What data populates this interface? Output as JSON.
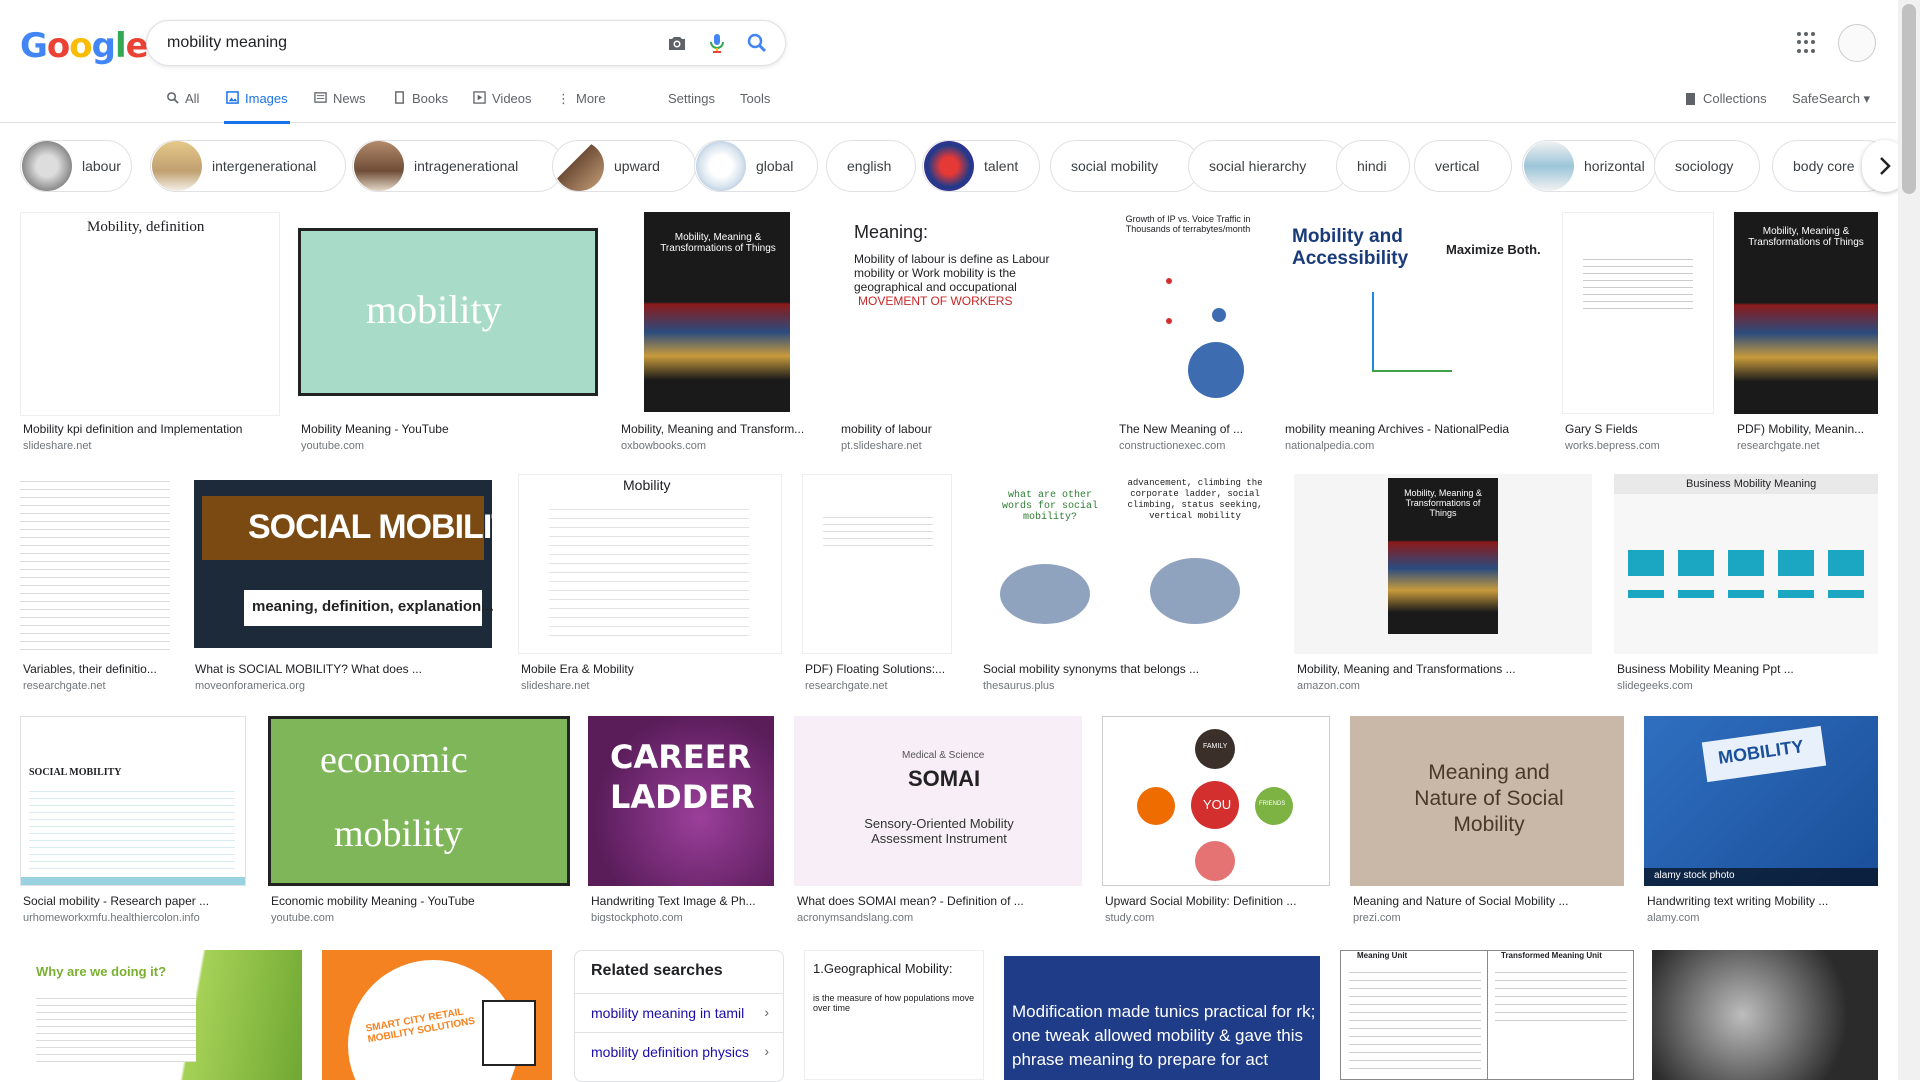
{
  "header": {
    "logo": [
      "G",
      "o",
      "o",
      "g",
      "l",
      "e"
    ],
    "logo_colors": [
      "#4285F4",
      "#EA4335",
      "#FBBC05",
      "#4285F4",
      "#34A853",
      "#EA4335"
    ],
    "query": "mobility meaning"
  },
  "tabs": {
    "all": "All",
    "images": "Images",
    "news": "News",
    "books": "Books",
    "videos": "Videos",
    "more": "More",
    "settings": "Settings",
    "tools": "Tools",
    "collections": "Collections",
    "safesearch": "SafeSearch"
  },
  "chips": [
    "labour",
    "intergenerational",
    "intragenerational",
    "upward",
    "global",
    "english",
    "talent",
    "social mobility",
    "social hierarchy",
    "hindi",
    "vertical",
    "horizontal",
    "sociology",
    "body core"
  ],
  "results": [
    {
      "title": "Mobility kpi definition and Implementation",
      "source": "slideshare.net",
      "overlay": "Mobility, definition"
    },
    {
      "title": "Mobility Meaning - YouTube",
      "source": "youtube.com",
      "overlay": "mobility"
    },
    {
      "title": "Mobility, Meaning and Transform...",
      "source": "oxbowbooks.com",
      "overlay": "Mobility, Meaning & Transformations of Things"
    },
    {
      "title": "mobility of labour",
      "source": "pt.slideshare.net",
      "overlay": "Meaning:",
      "overlay2": "Mobility of labour is define as Labour mobility or Work mobility is the geographical and occupational",
      "overlay3": "MOVEMENT OF WORKERS"
    },
    {
      "title": "The New Meaning of ...",
      "source": "constructionexec.com",
      "overlay": "Growth of IP vs. Voice Traffic in Thousands of terrabytes/month"
    },
    {
      "title": "mobility meaning Archives - NationalPedia",
      "source": "nationalpedia.com",
      "overlay": "Mobility and Accessibility",
      "overlay2": "Maximize Both."
    },
    {
      "title": "Gary S Fields",
      "source": "works.bepress.com",
      "overlay": ""
    },
    {
      "title": "PDF) Mobility, Meanin...",
      "source": "researchgate.net",
      "overlay": "Mobility, Meaning & Transformations of Things"
    },
    {
      "title": "Variables, their definitio...",
      "source": "researchgate.net",
      "overlay": ""
    },
    {
      "title": "What is SOCIAL MOBILITY? What does ...",
      "source": "moveonforamerica.org",
      "overlay": "SOCIAL MOBILITY",
      "overlay2": "meaning, definition, explanation..."
    },
    {
      "title": "Mobile Era & Mobility",
      "source": "slideshare.net",
      "overlay": "Mobility"
    },
    {
      "title": "PDF) Floating Solutions:...",
      "source": "researchgate.net",
      "overlay": ""
    },
    {
      "title": "Social mobility synonyms that belongs ...",
      "source": "thesaurus.plus",
      "overlay": "what are other words for social mobility?",
      "overlay2": "advancement, climbing the corporate ladder, social climbing, status seeking, vertical mobility"
    },
    {
      "title": "Mobility, Meaning and Transformations ...",
      "source": "amazon.com",
      "overlay": "Mobility, Meaning & Transformations of Things"
    },
    {
      "title": "Business Mobility Meaning Ppt ...",
      "source": "slidegeeks.com",
      "overlay": "Business Mobility Meaning"
    },
    {
      "title": "Social mobility - Research paper ...",
      "source": "urhomeworkxmfu.healthiercolon.info",
      "overlay": "SOCIAL MOBILITY"
    },
    {
      "title": "Economic mobility Meaning - YouTube",
      "source": "youtube.com",
      "overlay": "economic",
      "overlay2": "mobility"
    },
    {
      "title": "Handwriting Text Image & Ph...",
      "source": "bigstockphoto.com",
      "overlay": "CAREER",
      "overlay2": "LADDER"
    },
    {
      "title": "What does SOMAI mean? - Definition of ...",
      "source": "acronymsandslang.com",
      "overlay": "SOMAI",
      "overlay2": "Sensory-Oriented Mobility Assessment Instrument",
      "overlay3": "Medical & Science"
    },
    {
      "title": "Upward Social Mobility: Definition ...",
      "source": "study.com",
      "overlay": "YOU",
      "overlay2": "FAMILY",
      "overlay3": "FRIENDS"
    },
    {
      "title": "Meaning and Nature of Social Mobility ...",
      "source": "prezi.com",
      "overlay": "Meaning and Nature of Social Mobility"
    },
    {
      "title": "Handwriting text writing Mobility ...",
      "source": "alamy.com",
      "overlay": "MOBILITY",
      "overlay2": "alamy stock photo"
    }
  ],
  "row4": [
    {
      "overlay": "Why are we doing it?"
    },
    {
      "overlay": "SMART CITY RETAIL MOBILITY SOLUTIONS"
    },
    {
      "overlay": "1.Geographical Mobility:",
      "overlay2": "is the measure of how populations move over time"
    },
    {
      "overlay": "Modification made tunics practical for rk; one tweak allowed mobility & gave this phrase meaning to prepare for act"
    },
    {
      "overlay": "Meaning Unit",
      "overlay2": "Transformed Meaning Unit"
    },
    {
      "overlay": ""
    }
  ],
  "related": {
    "heading": "Related searches",
    "items": [
      "mobility meaning in tamil",
      "mobility definition physics"
    ]
  },
  "colors": {
    "accent": "#1a73e8",
    "link": "#1a0dab",
    "muted": "#70757a"
  }
}
